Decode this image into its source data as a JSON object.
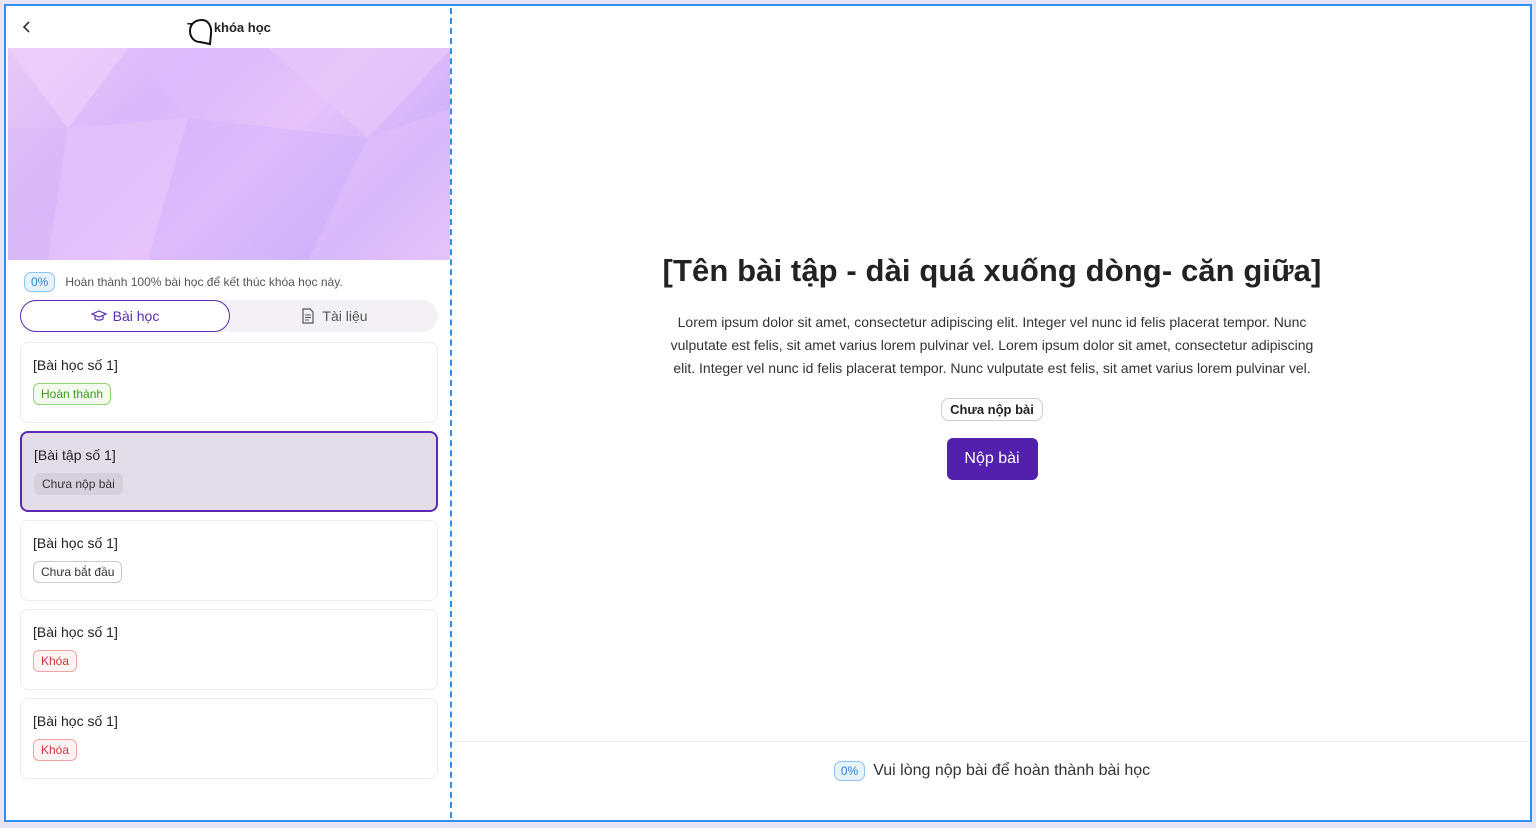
{
  "header": {
    "title": "Tên khóa học",
    "back_icon": "chevron-left-icon"
  },
  "progress": {
    "percent": "0%",
    "text": "Hoàn thành 100% bài học để kết thúc khóa học này."
  },
  "tabs": [
    {
      "label": "Bài học",
      "icon": "graduation-cap-icon",
      "active": true
    },
    {
      "label": "Tài liệu",
      "icon": "document-icon",
      "active": false
    }
  ],
  "lessons": [
    {
      "title": "[Bài học số 1]",
      "status": "Hoàn thành"
    },
    {
      "title": "[Bài tập số 1]",
      "status": "Chưa nộp bài"
    },
    {
      "title": "[Bài học số 1]",
      "status": "Chưa bắt đầu"
    },
    {
      "title": "[Bài học số 1]",
      "status": "Khóa"
    },
    {
      "title": "[Bài học số 1]",
      "status": "Khóa"
    }
  ],
  "main": {
    "title": "[Tên bài tập - dài quá xuống dòng- căn giữa]",
    "description": "Lorem ipsum dolor sit amet, consectetur adipiscing elit. Integer vel nunc id felis placerat tempor. Nunc vulputate est felis, sit amet varius lorem pulvinar vel. Lorem ipsum dolor sit amet, consectetur adipiscing elit. Integer vel nunc id felis placerat tempor. Nunc vulputate est felis, sit amet varius lorem pulvinar vel.",
    "status": "Chưa nộp bài",
    "submit_label": "Nộp bài"
  },
  "footer": {
    "percent": "0%",
    "text": "Vui lòng nộp bài để hoàn thành bài học"
  },
  "colors": {
    "accent": "#5320ad",
    "frame_border": "#2f8ff0"
  }
}
